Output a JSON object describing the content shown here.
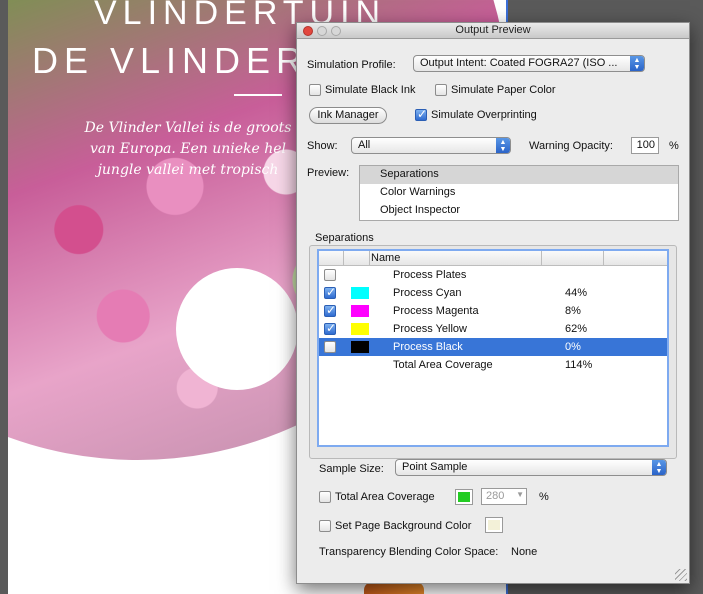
{
  "document": {
    "title_line1": "VLINDERTUIN",
    "title_line2": "DE VLINDER",
    "paragraph_lines": [
      "De Vlinder Vallei is de groots",
      "van Europa. Een unieke hel",
      "jungle vallei met tropisch"
    ]
  },
  "dialog": {
    "title": "Output Preview",
    "simulation_profile_label": "Simulation Profile:",
    "simulation_profile_value": "Output Intent: Coated FOGRA27 (ISO ...",
    "simulate_black_ink_label": "Simulate Black Ink",
    "simulate_paper_color_label": "Simulate Paper Color",
    "ink_manager_label": "Ink Manager",
    "simulate_overprinting_label": "Simulate Overprinting",
    "show_label": "Show:",
    "show_value": "All",
    "warning_opacity_label": "Warning Opacity:",
    "warning_opacity_value": "100",
    "warning_opacity_unit": "%",
    "preview_label": "Preview:",
    "preview_items": [
      "Separations",
      "Color Warnings",
      "Object Inspector"
    ],
    "separations_label": "Separations",
    "table_header_name": "Name",
    "separations": [
      {
        "name": "Process Plates",
        "pct": "",
        "checked": false,
        "color": ""
      },
      {
        "name": "Process Cyan",
        "pct": "44%",
        "checked": true,
        "color": "#00ffff"
      },
      {
        "name": "Process Magenta",
        "pct": "8%",
        "checked": true,
        "color": "#ff00ff"
      },
      {
        "name": "Process Yellow",
        "pct": "62%",
        "checked": true,
        "color": "#ffff00"
      },
      {
        "name": "Process Black",
        "pct": "0%",
        "checked": false,
        "color": "#000000"
      },
      {
        "name": "Total Area Coverage",
        "pct": "114%",
        "checked": false,
        "color": ""
      }
    ],
    "selected_separation": "Process Black",
    "sample_size_label": "Sample Size:",
    "sample_size_value": "Point Sample",
    "total_area_coverage_label": "Total Area Coverage",
    "total_area_coverage_value": "280",
    "total_area_coverage_unit": "%",
    "total_area_coverage_color": "#22cc22",
    "set_page_bg_label": "Set Page Background Color",
    "page_bg_color": "#f3f1d8",
    "transparency_label": "Transparency Blending Color Space:",
    "transparency_value": "None"
  },
  "colors": {
    "selection": "#3875d7",
    "close_button": "#e2473e"
  }
}
